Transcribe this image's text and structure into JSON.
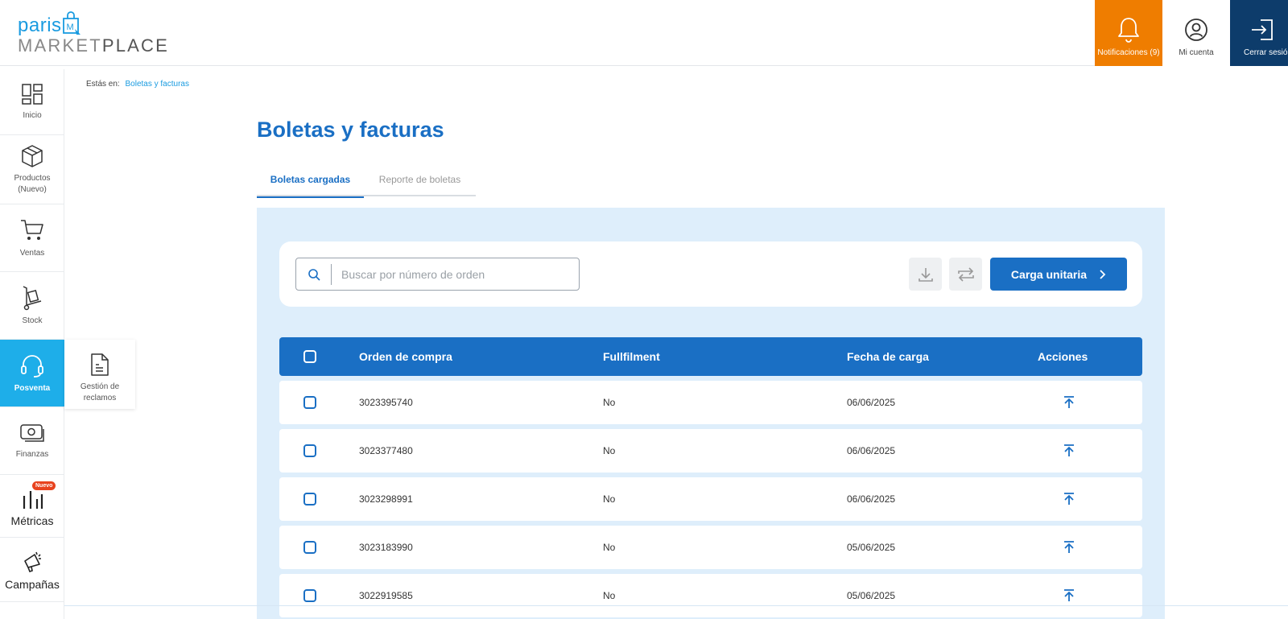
{
  "header": {
    "logo": {
      "line1": "paris",
      "line2_light": "MARKET",
      "line2_bold": "PLACE"
    },
    "notifications_label": "Notificaciones (9)",
    "account_label": "Mi cuenta",
    "logout_label": "Cerrar sesión",
    "colors": {
      "notifications": "#ef7d00",
      "logout": "#0d3c6b"
    }
  },
  "sidebar": {
    "items": [
      {
        "label": "Inicio",
        "icon": "dashboard-icon"
      },
      {
        "label": "Productos (Nuevo)",
        "icon": "box-icon"
      },
      {
        "label": "Ventas",
        "icon": "cart-icon"
      },
      {
        "label": "Stock",
        "icon": "hand-truck-icon"
      },
      {
        "label": "Posventa",
        "icon": "headset-icon",
        "active": true
      },
      {
        "label": "Finanzas",
        "icon": "money-icon"
      },
      {
        "label": "Métricas",
        "icon": "metrics-icon",
        "badge": "Nuevo"
      },
      {
        "label": "Campañas",
        "icon": "megaphone-icon"
      }
    ],
    "submenu": {
      "label": "Gestión de reclamos",
      "icon": "document-icon"
    },
    "active_color": "#1eaee9"
  },
  "breadcrumb": {
    "prefix": "Estás en:",
    "current": "Boletas y facturas"
  },
  "page": {
    "title": "Boletas y facturas",
    "tabs": [
      {
        "label": "Boletas cargadas",
        "active": true
      },
      {
        "label": "Reporte de boletas",
        "active": false
      }
    ]
  },
  "toolbar": {
    "search_placeholder": "Buscar por número de orden",
    "primary_button": "Carga unitaria",
    "primary_color": "#1a6fc4"
  },
  "table": {
    "headers": [
      "Orden de compra",
      "Fullfilment",
      "Fecha de carga",
      "Acciones"
    ],
    "rows": [
      {
        "orden": "3023395740",
        "fullfilment": "No",
        "fecha": "06/06/2025"
      },
      {
        "orden": "3023377480",
        "fullfilment": "No",
        "fecha": "06/06/2025"
      },
      {
        "orden": "3023298991",
        "fullfilment": "No",
        "fecha": "06/06/2025"
      },
      {
        "orden": "3023183990",
        "fullfilment": "No",
        "fecha": "05/06/2025"
      },
      {
        "orden": "3022919585",
        "fullfilment": "No",
        "fecha": "05/06/2025"
      }
    ]
  }
}
